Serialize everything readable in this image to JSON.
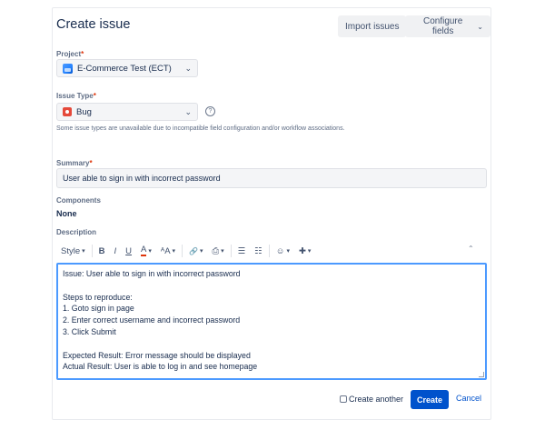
{
  "dialog": {
    "title": "Create issue",
    "import_label": "Import issues",
    "configure_label": "Configure fields"
  },
  "project": {
    "label": "Project",
    "required": "*",
    "value": "E-Commerce Test (ECT)"
  },
  "issue_type": {
    "label": "Issue Type",
    "required": "*",
    "value": "Bug",
    "help": "?",
    "note": "Some issue types are unavailable due to incompatible field configuration and/or workflow associations."
  },
  "summary": {
    "label": "Summary",
    "required": "*",
    "value": "User able to sign in with incorrect password"
  },
  "components": {
    "label": "Components",
    "value": "None"
  },
  "description": {
    "label": "Description",
    "toolbar": {
      "style": "Style",
      "bold": "B",
      "italic": "I",
      "underline": "U",
      "text_color": "A",
      "text_size": "ᴬA",
      "link": "🔗",
      "attachment": "⎙",
      "bullet_list": "☰",
      "numbered_list": "☷",
      "emoji": "☺",
      "insert": "✚",
      "collapse": "⌃"
    },
    "lines": [
      "Issue: User able to sign in with incorrect password",
      "",
      "Steps to reproduce:",
      "1. Goto sign in page",
      "2. Enter correct username and incorrect password",
      "3. Click Submit",
      "",
      "Expected Result: Error message should be displayed",
      "Actual Result: User is able to log in and see homepage"
    ]
  },
  "footer": {
    "create_another": "Create another",
    "create": "Create",
    "cancel": "Cancel"
  },
  "colors": {
    "primary": "#0052cc",
    "focus": "#4c9aff",
    "required": "#de350b",
    "bug": "#e5493a"
  }
}
